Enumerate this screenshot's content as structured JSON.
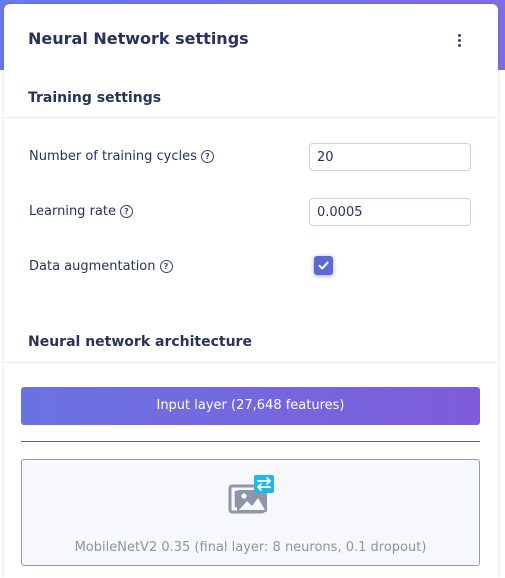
{
  "header": {
    "title": "Neural Network settings",
    "menu_icon": "kebab-menu-icon"
  },
  "training_settings": {
    "heading": "Training settings",
    "cycles": {
      "label": "Number of training cycles",
      "value": "20"
    },
    "learning_rate": {
      "label": "Learning rate",
      "value": "0.0005"
    },
    "augmentation": {
      "label": "Data augmentation",
      "checked": true
    },
    "help_icon": "question-circle-icon"
  },
  "architecture": {
    "heading": "Neural network architecture",
    "input_layer": "Input layer (27,648 features)",
    "model_block": {
      "label": "MobileNetV2 0.35 (final layer: 8 neurons, 0.1 dropout)",
      "icon": "image-transfer-icon"
    }
  },
  "colors": {
    "accent": "#6b79e6",
    "title_text": "#27335a",
    "checkbox": "#5b68d6",
    "transfer_badge": "#1eb8ea"
  }
}
